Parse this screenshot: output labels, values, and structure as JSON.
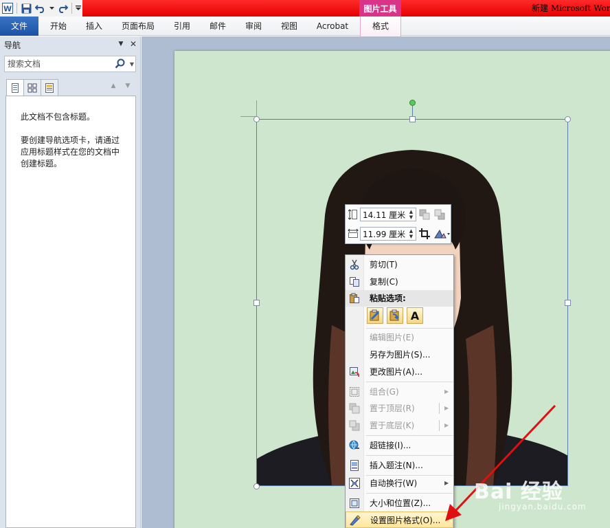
{
  "titlebar": {
    "picture_tools": "图片工具",
    "doc_title": "新建 Microsoft Wor"
  },
  "ribbon": {
    "tabs": [
      "文件",
      "开始",
      "插入",
      "页面布局",
      "引用",
      "邮件",
      "审阅",
      "视图",
      "Acrobat",
      "格式"
    ],
    "active_tab": "格式"
  },
  "nav": {
    "title": "导航",
    "search_placeholder": "搜索文档",
    "msg1": "此文档不包含标题。",
    "msg2": "要创建导航选项卡，请通过应用标题样式在您的文档中创建标题。"
  },
  "minibar": {
    "height_value": "14.11 厘米",
    "width_value": "11.99 厘米"
  },
  "context_menu": {
    "items": [
      {
        "label": "剪切(T)",
        "icon": "scissors-icon",
        "disabled": false
      },
      {
        "label": "复制(C)",
        "icon": "copy-icon",
        "disabled": false
      },
      {
        "label": "粘贴选项:",
        "icon": "paste-icon",
        "disabled": false
      },
      {
        "label": "编辑图片(E)",
        "icon": "",
        "disabled": true
      },
      {
        "label": "另存为图片(S)...",
        "icon": "",
        "disabled": false
      },
      {
        "label": "更改图片(A)...",
        "icon": "change-picture-icon",
        "disabled": false
      },
      {
        "label": "组合(G)",
        "icon": "group-icon",
        "disabled": true
      },
      {
        "label": "置于顶层(R)",
        "icon": "bring-front-icon",
        "disabled": true
      },
      {
        "label": "置于底层(K)",
        "icon": "send-back-icon",
        "disabled": true
      },
      {
        "label": "超链接(I)...",
        "icon": "hyperlink-icon",
        "disabled": false
      },
      {
        "label": "插入题注(N)...",
        "icon": "caption-icon",
        "disabled": false
      },
      {
        "label": "自动换行(W)",
        "icon": "wrap-text-icon",
        "disabled": false
      },
      {
        "label": "大小和位置(Z)...",
        "icon": "size-position-icon",
        "disabled": false
      },
      {
        "label": "设置图片格式(O)...",
        "icon": "format-picture-icon",
        "disabled": false
      }
    ],
    "paste_option_text": "A"
  },
  "watermark": {
    "brand": "Bai 经验",
    "url": "jingyan.baidu.com"
  },
  "colors": {
    "title_red": "#e50000",
    "picture_tools_pink": "#d9338a",
    "file_tab_blue": "#1c52a6",
    "page_bg": "#cde6cd",
    "arrow_red": "#e01010"
  }
}
